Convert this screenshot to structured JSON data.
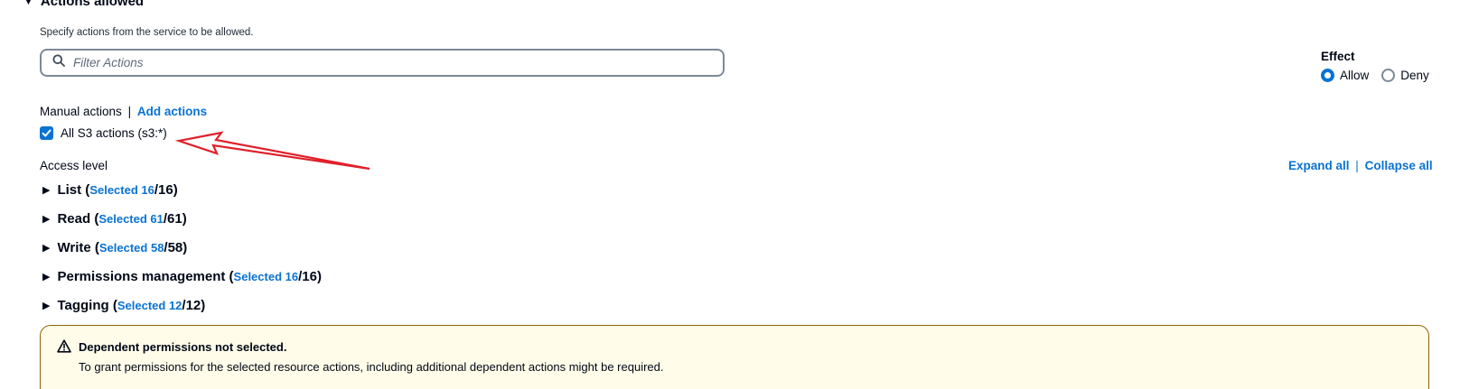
{
  "section": {
    "title": "Actions allowed",
    "description": "Specify actions from the service to be allowed."
  },
  "filter": {
    "placeholder": "Filter Actions"
  },
  "effect": {
    "title": "Effect",
    "options": [
      {
        "label": "Allow",
        "selected": true
      },
      {
        "label": "Deny",
        "selected": false
      }
    ]
  },
  "manual": {
    "label": "Manual actions",
    "separator": "|",
    "add_actions": "Add actions"
  },
  "all_actions": {
    "label": "All S3 actions (s3:*)",
    "checked": true
  },
  "access_level": {
    "label": "Access level",
    "expand_all": "Expand all",
    "separator": "|",
    "collapse_all": "Collapse all",
    "groups": [
      {
        "name": "List",
        "selected_text": "Selected 16",
        "total": "/16"
      },
      {
        "name": "Read",
        "selected_text": "Selected 61",
        "total": "/61"
      },
      {
        "name": "Write",
        "selected_text": "Selected 58",
        "total": "/58"
      },
      {
        "name": "Permissions management",
        "selected_text": "Selected 16",
        "total": "/16"
      },
      {
        "name": "Tagging",
        "selected_text": "Selected 12",
        "total": "/12"
      }
    ]
  },
  "alert": {
    "title": "Dependent permissions not selected.",
    "text": "To grant permissions for the selected resource actions, including additional dependent actions might be required."
  },
  "colors": {
    "link": "#0972d3",
    "alert_bg": "#fffce9",
    "alert_border": "#8d6605",
    "annotation_arrow": "#e0202a"
  },
  "icons": {
    "collapse": "caret-down-icon",
    "search": "search-icon",
    "check": "check-icon",
    "expand": "caret-right-icon",
    "warning": "warning-icon"
  }
}
